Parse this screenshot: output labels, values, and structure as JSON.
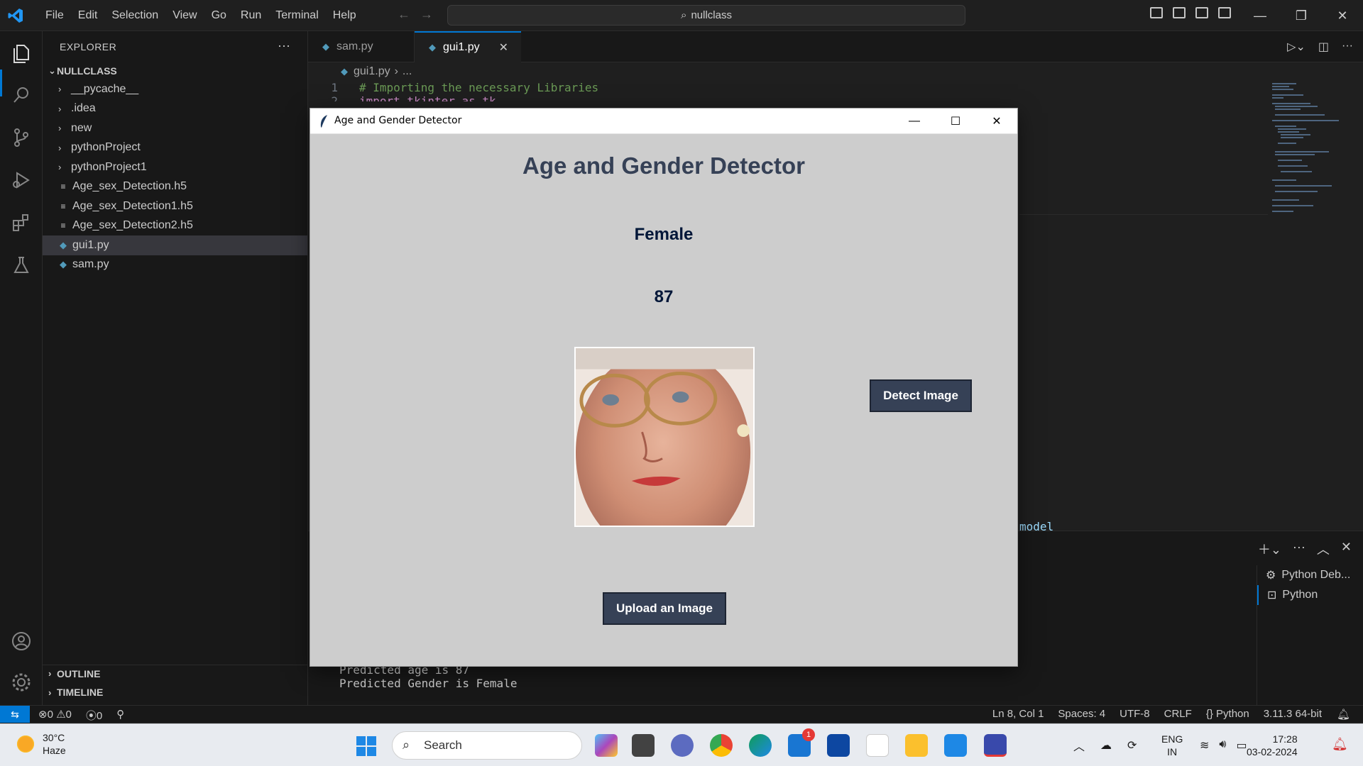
{
  "menu": [
    "File",
    "Edit",
    "Selection",
    "View",
    "Go",
    "Run",
    "Terminal",
    "Help"
  ],
  "search": {
    "text": "nullclass"
  },
  "sidebar": {
    "title": "EXPLORER",
    "root": "NULLCLASS",
    "items": [
      {
        "label": "__pycache__",
        "kind": "folder"
      },
      {
        "label": ".idea",
        "kind": "folder"
      },
      {
        "label": "new",
        "kind": "folder"
      },
      {
        "label": "pythonProject",
        "kind": "folder"
      },
      {
        "label": "pythonProject1",
        "kind": "folder"
      },
      {
        "label": "Age_sex_Detection.h5",
        "kind": "file"
      },
      {
        "label": "Age_sex_Detection1.h5",
        "kind": "file"
      },
      {
        "label": "Age_sex_Detection2.h5",
        "kind": "file"
      },
      {
        "label": "gui1.py",
        "kind": "python",
        "selected": true
      },
      {
        "label": "sam.py",
        "kind": "python"
      }
    ],
    "outline": "OUTLINE",
    "timeline": "TIMELINE"
  },
  "tabs": [
    {
      "label": "sam.py",
      "active": false
    },
    {
      "label": "gui1.py",
      "active": true
    }
  ],
  "breadcrumb": {
    "file": "gui1.py",
    "rest": "..."
  },
  "code": {
    "line1_no": "1",
    "line1": "# Importing the necessary Libraries",
    "line2_no": "2",
    "line2": "import tkinter as tk",
    "partial": "model"
  },
  "terminal": {
    "items": [
      "Python Deb...",
      "Python"
    ],
    "output_line1": "Predicted age is 87",
    "output_line2": "Predicted Gender is Female"
  },
  "status": {
    "errors": "0",
    "warnings": "0",
    "ports": "0",
    "position": "Ln 8, Col 1",
    "spaces": "Spaces: 4",
    "encoding": "UTF-8",
    "eol": "CRLF",
    "language": "Python",
    "interpreter": "3.11.3 64-bit"
  },
  "dialog": {
    "window_title": "Age and Gender Detector",
    "heading": "Age and Gender Detector",
    "gender": "Female",
    "age": "87",
    "detect_button": "Detect Image",
    "upload_button": "Upload an Image"
  },
  "taskbar": {
    "temp": "30°C",
    "weather": "Haze",
    "search": "Search",
    "notification_badge": "1",
    "lang1": "ENG",
    "lang2": "IN",
    "time": "17:28",
    "date": "03-02-2024"
  },
  "colors": {
    "accent": "#0078d4",
    "button_bg": "#364156",
    "heading": "#364156",
    "result_text": "#011638",
    "dialog_bg": "#cdcdcd"
  }
}
